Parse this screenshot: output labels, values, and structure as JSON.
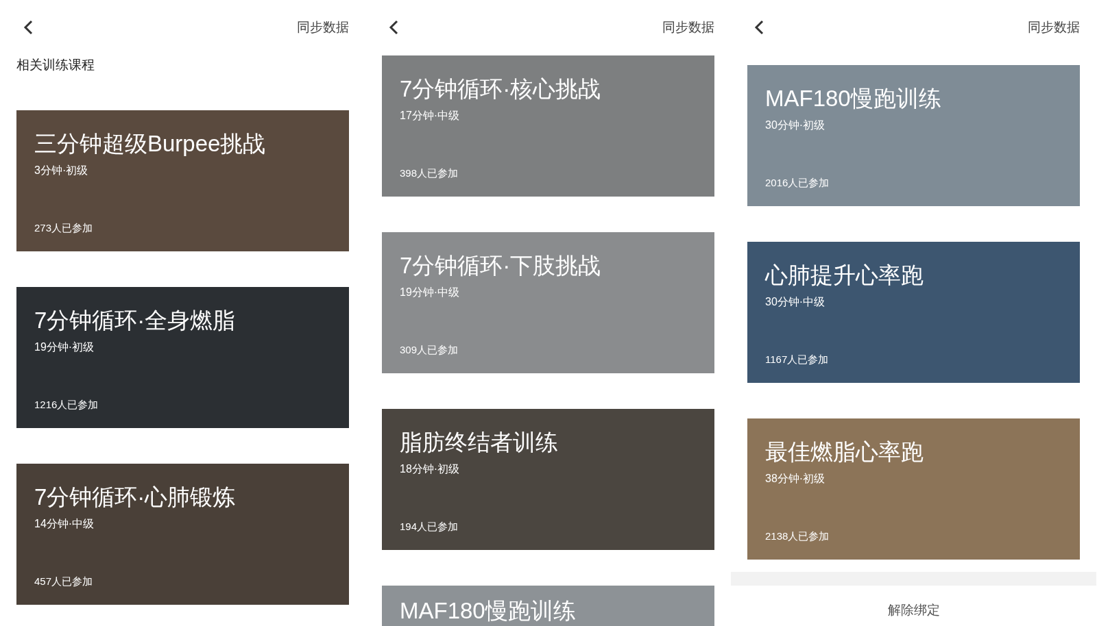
{
  "screens": [
    {
      "action": "同步数据",
      "section_title": "相关训练课程",
      "courses": [
        {
          "title": "三分钟超级Burpee挑战",
          "meta": "3分钟·初级",
          "participants": "273人已参加"
        },
        {
          "title": "7分钟循环·全身燃脂",
          "meta": "19分钟·初级",
          "participants": "1216人已参加"
        },
        {
          "title": "7分钟循环·心肺锻炼",
          "meta": "14分钟·中级",
          "participants": "457人已参加"
        }
      ]
    },
    {
      "action": "同步数据",
      "courses": [
        {
          "title": "7分钟循环·核心挑战",
          "meta": "17分钟·中级",
          "participants": "398人已参加"
        },
        {
          "title": "7分钟循环·下肢挑战",
          "meta": "19分钟·中级",
          "participants": "309人已参加"
        },
        {
          "title": "脂肪终结者训练",
          "meta": "18分钟·初级",
          "participants": "194人已参加"
        },
        {
          "title": "MAF180慢跑训练"
        }
      ]
    },
    {
      "action": "同步数据",
      "courses": [
        {
          "title": "MAF180慢跑训练",
          "meta": "30分钟·初级",
          "participants": "2016人已参加"
        },
        {
          "title": "心肺提升心率跑",
          "meta": "30分钟·中级",
          "participants": "1167人已参加"
        },
        {
          "title": "最佳燃脂心率跑",
          "meta": "38分钟·初级",
          "participants": "2138人已参加"
        }
      ],
      "footer_button": "解除绑定"
    }
  ]
}
